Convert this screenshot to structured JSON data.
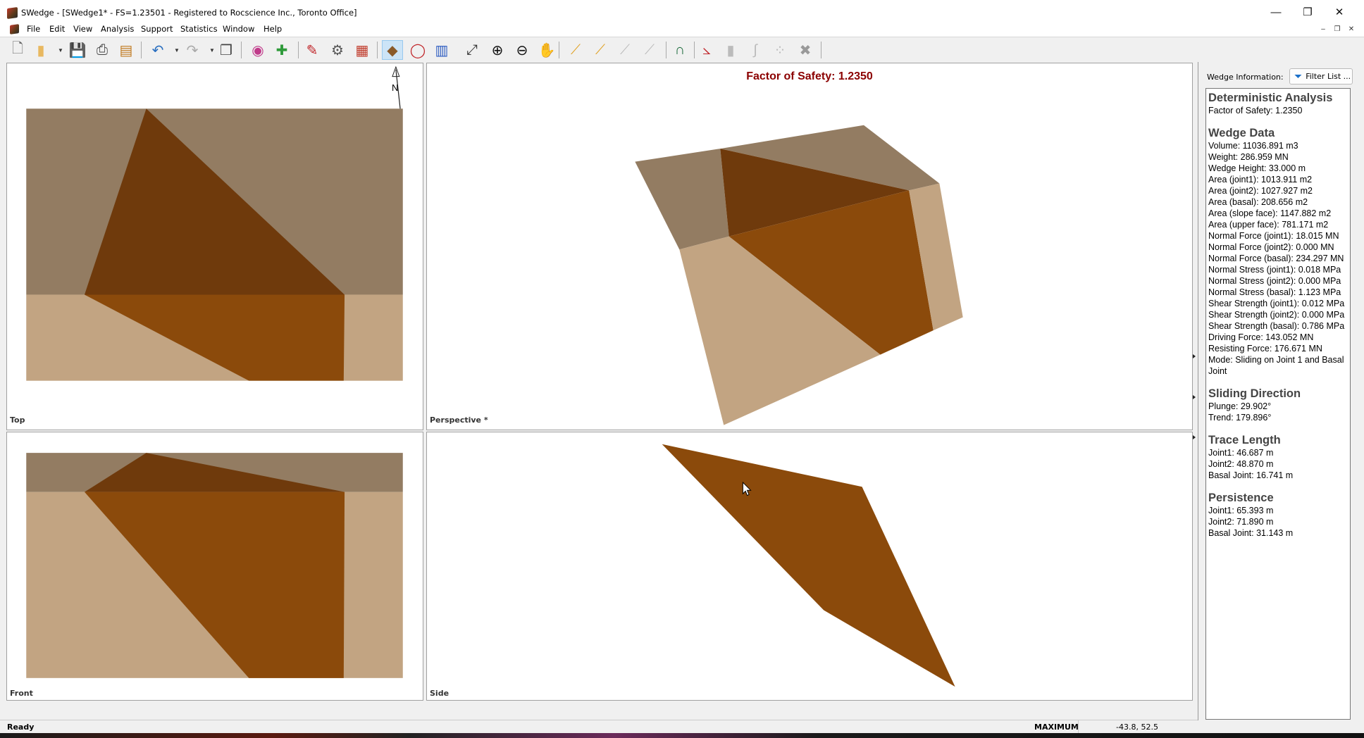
{
  "window": {
    "title": "SWedge - [SWedge1* - FS=1.23501 - Registered to Rocscience Inc., Toronto Office]",
    "minimize": "—",
    "maximize": "❐",
    "close": "✕"
  },
  "menu": {
    "items": [
      "File",
      "Edit",
      "View",
      "Analysis",
      "Support",
      "Statistics",
      "Window",
      "Help"
    ],
    "mdi": [
      "–",
      "❐",
      "✕"
    ]
  },
  "toolbar": {
    "icons": [
      "new-file-icon",
      "open-folder-icon",
      "save-icon",
      "print-icon",
      "export-icon",
      "undo-icon",
      "redo-icon",
      "copy-icon",
      "display-options-icon",
      "add-graph-icon",
      "input-data-icon",
      "project-settings-icon",
      "compute-icon",
      "wedge-view-icon",
      "stereonet-icon",
      "four-view-icon",
      "zoom-extents-icon",
      "zoom-in-icon",
      "zoom-out-icon",
      "pan-icon",
      "edit-support-icon",
      "add-support-icon",
      "delete-support-icon",
      "support-properties-icon",
      "magnet-icon",
      "plot-chart-icon",
      "histogram-icon",
      "cumulative-icon",
      "scatter-icon",
      "excel-icon"
    ],
    "active": "wedge-view-icon"
  },
  "views": {
    "top": "Top",
    "perspective": "Perspective *",
    "front": "Front",
    "side": "Side",
    "north": "N",
    "fos_title": "Factor of Safety: 1.2350"
  },
  "colors": {
    "dark_wedge": "#6f3a0c",
    "wedge_face": "#8b4a0b",
    "slope_upper": "#937c62",
    "slope_face": "#c2a482",
    "fos_title": "#8b0000"
  },
  "info_panel": {
    "label": "Wedge Information:",
    "filter_button": "Filter List ...",
    "sections": [
      {
        "heading": "Deterministic Analysis",
        "lines": [
          "Factor of Safety: 1.2350"
        ]
      },
      {
        "heading": "Wedge Data",
        "lines": [
          "Volume: 11036.891 m3",
          "Weight: 286.959 MN",
          "Wedge Height: 33.000 m",
          "Area (joint1): 1013.911 m2",
          "Area (joint2): 1027.927 m2",
          "Area (basal): 208.656 m2",
          "Area (slope face): 1147.882 m2",
          "Area (upper face): 781.171 m2",
          "Normal Force (joint1): 18.015 MN",
          "Normal Force (joint2): 0.000 MN",
          "Normal Force (basal): 234.297 MN",
          "Normal Stress (joint1): 0.018 MPa",
          "Normal Stress (joint2): 0.000 MPa",
          "Normal Stress (basal): 1.123 MPa",
          "Shear Strength (joint1): 0.012 MPa",
          "Shear Strength (joint2): 0.000 MPa",
          "Shear Strength (basal): 0.786 MPa",
          "Driving Force: 143.052 MN",
          "Resisting Force: 176.671 MN",
          "Mode: Sliding on Joint 1 and Basal",
          "Joint"
        ]
      },
      {
        "heading": "Sliding Direction",
        "lines": [
          "Plunge: 29.902°",
          "Trend: 179.896°"
        ]
      },
      {
        "heading": "Trace Length",
        "lines": [
          "Joint1: 46.687 m",
          "Joint2: 48.870 m",
          "Basal Joint: 16.741 m"
        ]
      },
      {
        "heading": "Persistence",
        "lines": [
          "Joint1: 65.393 m",
          "Joint2: 71.890 m",
          "Basal Joint: 31.143 m"
        ]
      }
    ]
  },
  "status": {
    "text": "Ready",
    "mode": "MAXIMUM",
    "coords": "-43.8, 52.5"
  }
}
